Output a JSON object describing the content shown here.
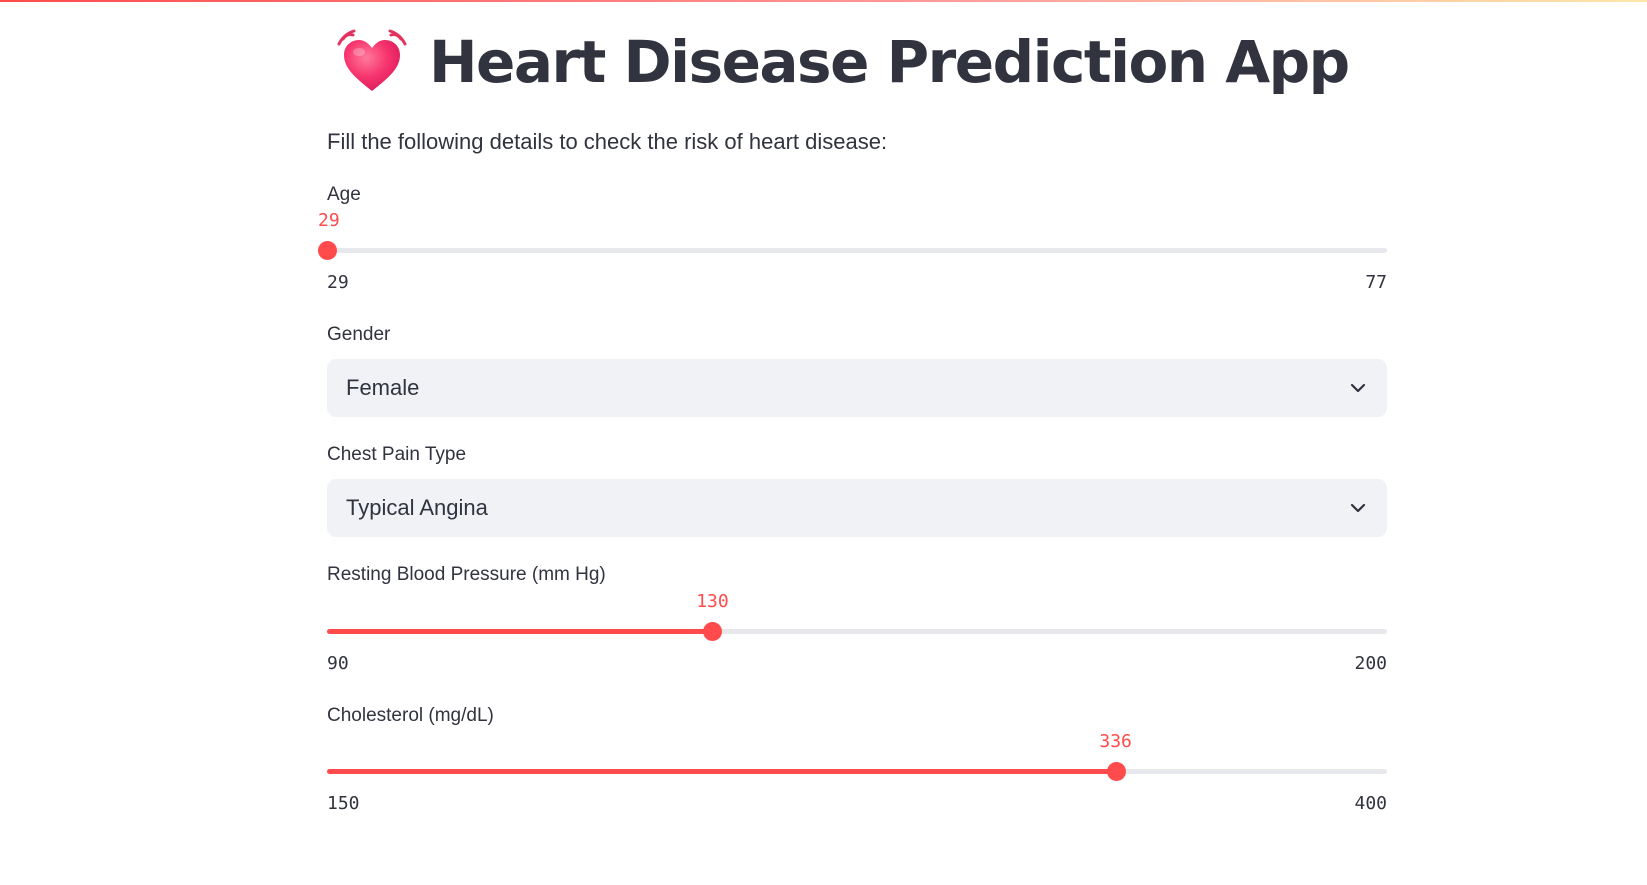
{
  "app": {
    "title": "Heart Disease Prediction App",
    "subtitle": "Fill the following details to check the risk of heart disease:",
    "icon": "beating-heart-icon",
    "accent_color": "#ff4b4b"
  },
  "fields": {
    "age": {
      "label": "Age",
      "value": 29,
      "value_text": "29",
      "min": 29,
      "max": 77,
      "min_text": "29",
      "max_text": "77"
    },
    "gender": {
      "label": "Gender",
      "selected": "Female"
    },
    "chest_pain": {
      "label": "Chest Pain Type",
      "selected": "Typical Angina"
    },
    "resting_bp": {
      "label": "Resting Blood Pressure (mm Hg)",
      "value": 130,
      "value_text": "130",
      "min": 90,
      "max": 200,
      "min_text": "90",
      "max_text": "200"
    },
    "cholesterol": {
      "label": "Cholesterol (mg/dL)",
      "value": 336,
      "value_text": "336",
      "min": 150,
      "max": 400,
      "min_text": "150",
      "max_text": "400"
    }
  }
}
